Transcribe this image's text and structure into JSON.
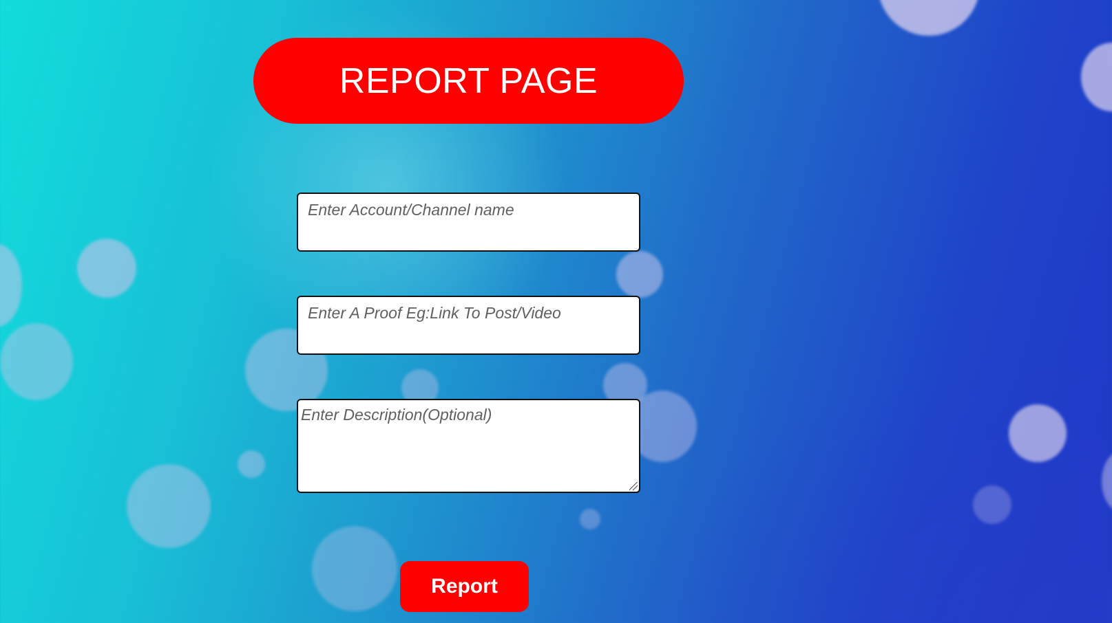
{
  "page": {
    "title": "REPORT PAGE"
  },
  "form": {
    "account_placeholder": "Enter Account/Channel name",
    "account_value": "",
    "proof_placeholder": "Enter A Proof Eg:Link To Post/Video",
    "proof_value": "",
    "description_placeholder": "Enter Description(Optional)",
    "description_value": "",
    "submit_label": "Report"
  },
  "colors": {
    "accent": "#ff0000",
    "text_on_accent": "#ffffff",
    "background_start": "#12dcdc",
    "background_end": "#1f37c8"
  },
  "icons": {
    "textarea_resize": "resize-grip-icon"
  }
}
